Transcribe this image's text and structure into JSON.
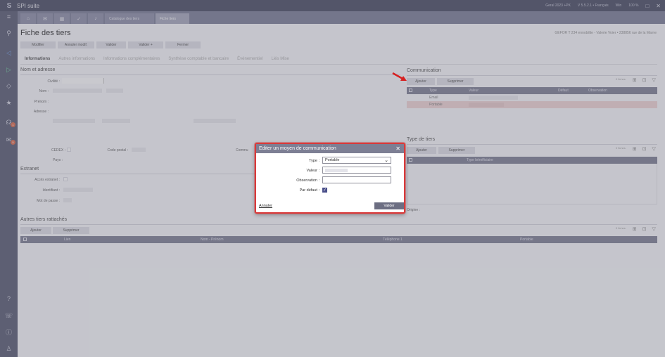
{
  "app": {
    "title": "SPI suite"
  },
  "titlebar_right": [
    "Geral 2023 +PK",
    "V 5.5.2.1 • Français",
    "Win",
    "100 %"
  ],
  "window_controls": {
    "restore": "□",
    "close": "✕"
  },
  "tabs": [
    {
      "icon": "home-icon",
      "glyph": "⌂"
    },
    {
      "icon": "mail-icon",
      "glyph": "✉"
    },
    {
      "icon": "calendar-icon",
      "glyph": "▦"
    },
    {
      "icon": "check-icon",
      "glyph": "✓"
    },
    {
      "icon": "bell-icon",
      "glyph": "♪"
    }
  ],
  "text_tabs": [
    "Catalogue des tiers",
    "Fiche tiers"
  ],
  "sidebar": [
    {
      "icon": "menu-icon",
      "glyph": "≡"
    },
    {
      "icon": "search-icon",
      "glyph": "⚲"
    },
    {
      "icon": "nav-left-icon",
      "glyph": "◁"
    },
    {
      "icon": "nav-right-icon",
      "glyph": "▷"
    },
    {
      "icon": "code-icon",
      "glyph": "◇"
    },
    {
      "icon": "star-icon",
      "glyph": "★"
    },
    {
      "icon": "bell-icon",
      "glyph": "☊",
      "badge": "1"
    },
    {
      "icon": "mail-icon",
      "glyph": "✉",
      "badge": "5"
    },
    {
      "icon": "help-icon",
      "glyph": "?"
    },
    {
      "icon": "support-icon",
      "glyph": "☏"
    },
    {
      "icon": "info-icon",
      "glyph": "ⓘ"
    },
    {
      "icon": "user-icon",
      "glyph": "♙"
    }
  ],
  "page": {
    "title": "Fiche des tiers",
    "info": "GEFOR T 234 ennobilite - Valerie Voier • 238856 rue de la Marne",
    "actions": [
      "Modifier",
      "Annuler modif.",
      "Valider",
      "Valider +",
      "Fermer"
    ],
    "tabs": [
      "Informations",
      "Autres informations",
      "Informations complémentaires",
      "Synthèse comptable et bancaire",
      "Événementiel",
      "Liés Mise"
    ]
  },
  "nom_adresse": {
    "title": "Nom et adresse",
    "labels": [
      "Civilité :",
      "Nom :",
      "Prénom :",
      "Adresse :"
    ],
    "cedex": "CEDEX :",
    "code_postal": "Code postal :",
    "pays": "Pays :",
    "communication_trunc": "Commu"
  },
  "extranet": {
    "title": "Extranet",
    "labels": [
      "Accès extranet :",
      "Identifiant :",
      "Mot de passe :"
    ]
  },
  "autres": {
    "title": "Autres tiers rattachés",
    "buttons": [
      "Ajouter",
      "Supprimer"
    ],
    "count": "0 fiches",
    "columns": [
      "Lien",
      "Nom - Prénom",
      "Téléphone 1",
      "Portable"
    ]
  },
  "communication": {
    "title": "Communication",
    "buttons": [
      "Ajouter",
      "Supprimer"
    ],
    "count": "0 fiches",
    "columns": [
      "Type",
      "Valeur",
      "Défaut",
      "Observation"
    ],
    "rows": [
      "Email",
      "Portable"
    ]
  },
  "type_tiers": {
    "title": "Type de tiers",
    "buttons": [
      "Ajouter",
      "Supprimer"
    ],
    "count": "0 fiches",
    "columns": [
      "Type bénéficiaire"
    ],
    "origine": "Origine :"
  },
  "dialog": {
    "title": "Editer un moyen de communication",
    "close": "✕",
    "type_label": "Type :",
    "type_value": "Portable",
    "valeur_label": "Valeur :",
    "observation_label": "Observation :",
    "observation_value": "",
    "defaut_label": "Par défaut :",
    "defaut_checked": "✓",
    "cancel": "Annuler",
    "ok": "Valider"
  }
}
